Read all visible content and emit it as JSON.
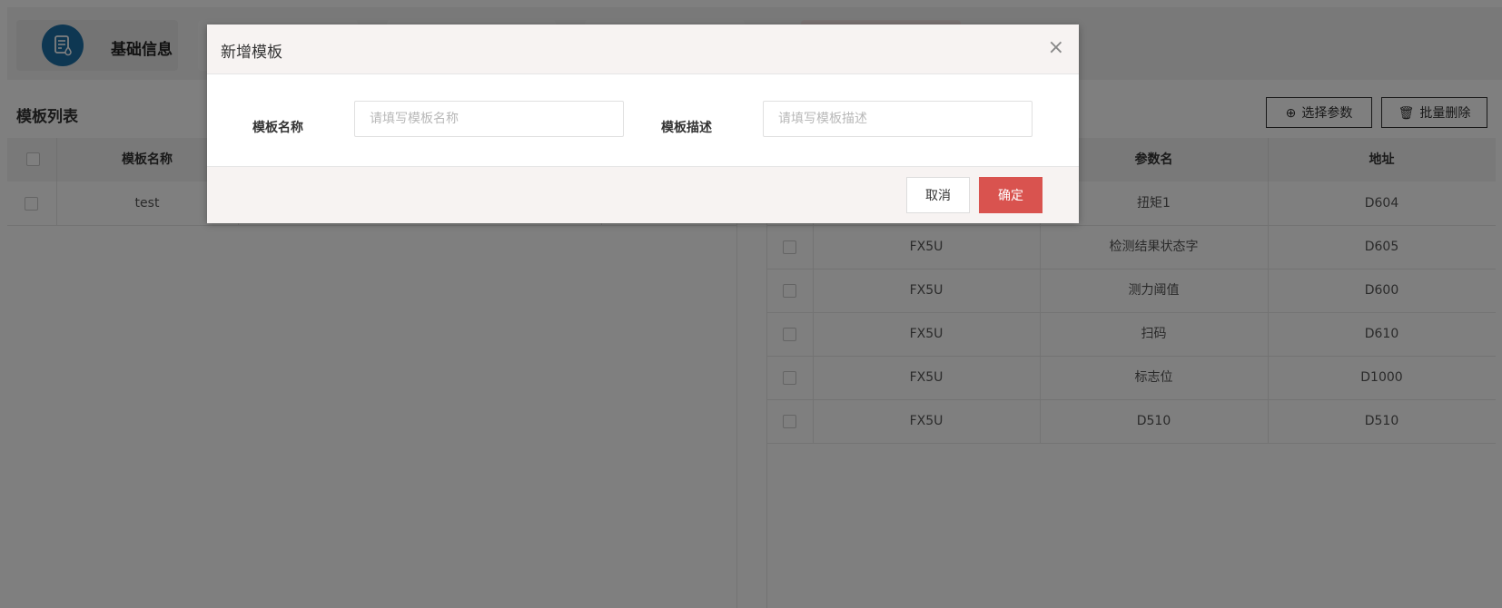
{
  "nav": {
    "active_label": "基础信息"
  },
  "left": {
    "title": "模板列表",
    "headers": [
      "模板名称"
    ],
    "rows": [
      {
        "name": "test"
      }
    ]
  },
  "right": {
    "buttons": {
      "select_params": "选择参数",
      "batch_delete": "批量删除"
    },
    "headers": [
      "参数名",
      "地址"
    ],
    "rows": [
      {
        "device": "",
        "param": "扭矩1",
        "address": "D604"
      },
      {
        "device": "FX5U",
        "param": "检测结果状态字",
        "address": "D605"
      },
      {
        "device": "FX5U",
        "param": "测力阈值",
        "address": "D600"
      },
      {
        "device": "FX5U",
        "param": "扫码",
        "address": "D610"
      },
      {
        "device": "FX5U",
        "param": "标志位",
        "address": "D1000"
      },
      {
        "device": "FX5U",
        "param": "D510",
        "address": "D510"
      }
    ]
  },
  "modal": {
    "title": "新增模板",
    "close_icon": "×",
    "name_label": "模板名称",
    "name_placeholder": "请填写模板名称",
    "name_value": "",
    "desc_label": "模板描述",
    "desc_placeholder": "请填写模板描述",
    "desc_value": "",
    "cancel": "取消",
    "confirm": "确定",
    "confirm_color": "#d9534f"
  },
  "colors": {
    "nav_icon_bg": "#1d6fa5",
    "overlay": "rgba(0,0,0,0.5)"
  }
}
